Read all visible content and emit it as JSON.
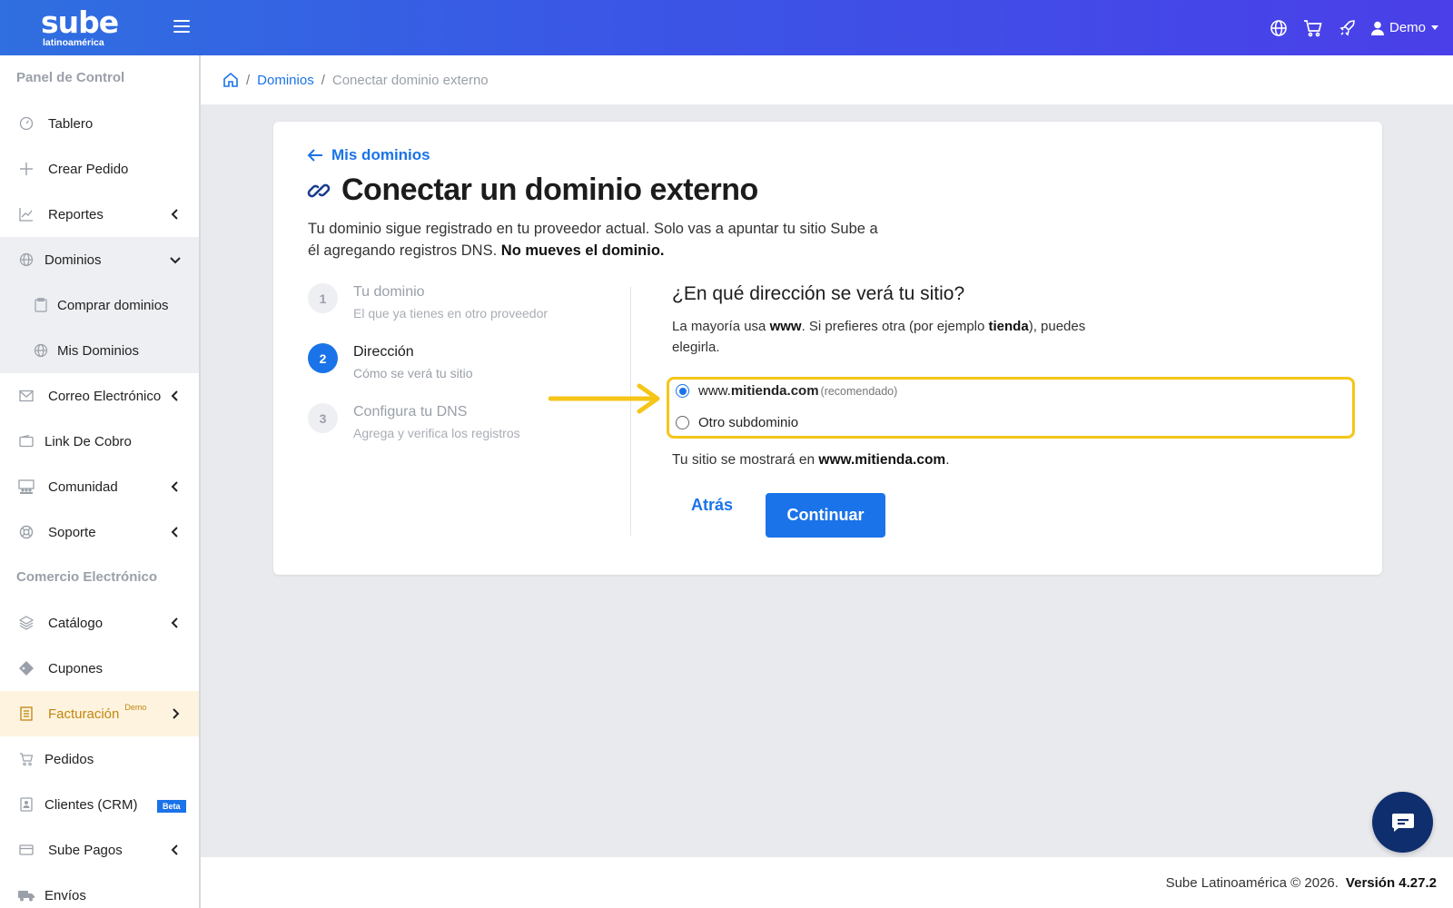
{
  "brand": {
    "name": "sube",
    "sub": "latinoamérica"
  },
  "topbar": {
    "user_label": "Demo"
  },
  "sidebar": {
    "section_1": "Panel de Control",
    "items": [
      {
        "label": "Tablero",
        "icon": "gauge-icon"
      },
      {
        "label": "Crear Pedido",
        "icon": "plus-icon"
      },
      {
        "label": "Reportes",
        "icon": "chart-line-icon"
      },
      {
        "label": "Dominios",
        "icon": "globe-icon"
      },
      {
        "label": "Comprar dominios",
        "icon": "clipboard-icon"
      },
      {
        "label": "Mis Dominios",
        "icon": "globe-icon"
      },
      {
        "label": "Correo Electrónico",
        "icon": "envelope-icon"
      },
      {
        "label": "Link De Cobro",
        "icon": "wallet-icon"
      },
      {
        "label": "Comunidad",
        "icon": "community-icon"
      },
      {
        "label": "Soporte",
        "icon": "lifebuoy-icon"
      }
    ],
    "section_2": "Comercio Electrónico",
    "items2": [
      {
        "label": "Catálogo",
        "icon": "layers-icon"
      },
      {
        "label": "Cupones",
        "icon": "ticket-icon"
      },
      {
        "label": "Facturación",
        "sup": "Demo",
        "icon": "invoice-icon"
      },
      {
        "label": "Pedidos",
        "icon": "cart-icon"
      },
      {
        "label": "Clientes (CRM)",
        "badge": "Beta",
        "icon": "contact-card-icon"
      },
      {
        "label": "Sube Pagos",
        "icon": "credit-card-icon"
      },
      {
        "label": "Envíos",
        "icon": "truck-icon"
      }
    ]
  },
  "breadcrumb": {
    "link": "Dominios",
    "current": "Conectar dominio externo"
  },
  "card": {
    "back_label": "Mis dominios",
    "title": "Conectar un dominio externo",
    "intro_1": "Tu dominio sigue registrado en tu proveedor actual. Solo vas a apuntar tu sitio Sube a",
    "intro_2": "él agregando registros DNS.",
    "intro_bold": "No mueves el dominio.",
    "steps": [
      {
        "num": "1",
        "title": "Tu dominio",
        "desc": "El que ya tienes en otro proveedor"
      },
      {
        "num": "2",
        "title": "Dirección",
        "desc": "Cómo se verá tu sitio"
      },
      {
        "num": "3",
        "title": "Configura tu DNS",
        "desc": "Agrega y verifica los registros"
      }
    ],
    "question": "¿En qué dirección se verá tu sitio?",
    "q_desc_1": "La mayoría usa",
    "q_desc_www": "www",
    "q_desc_2": ". Si prefieres otra (por ejemplo",
    "q_desc_tienda": "tienda",
    "q_desc_3": "), puedes",
    "q_desc_4": "elegirla.",
    "options": [
      {
        "prefix": "www.",
        "domain": "mitienda.com",
        "note": "(recomendado)",
        "selected": true
      },
      {
        "label": "Otro subdominio",
        "selected": false
      }
    ],
    "result_prefix": "Tu sitio se mostrará en",
    "result_domain": "www.mitienda.com",
    "result_suffix": ".",
    "btn_back": "Atrás",
    "btn_continue": "Continuar"
  },
  "footer": {
    "copyright": "Sube Latinoamérica © 2026.",
    "version": "Versión 4.27.2"
  },
  "colors": {
    "primary": "#1a73e8",
    "highlight": "#f5c518",
    "active_bg": "#fdf3df",
    "active_text": "#c2860e"
  }
}
